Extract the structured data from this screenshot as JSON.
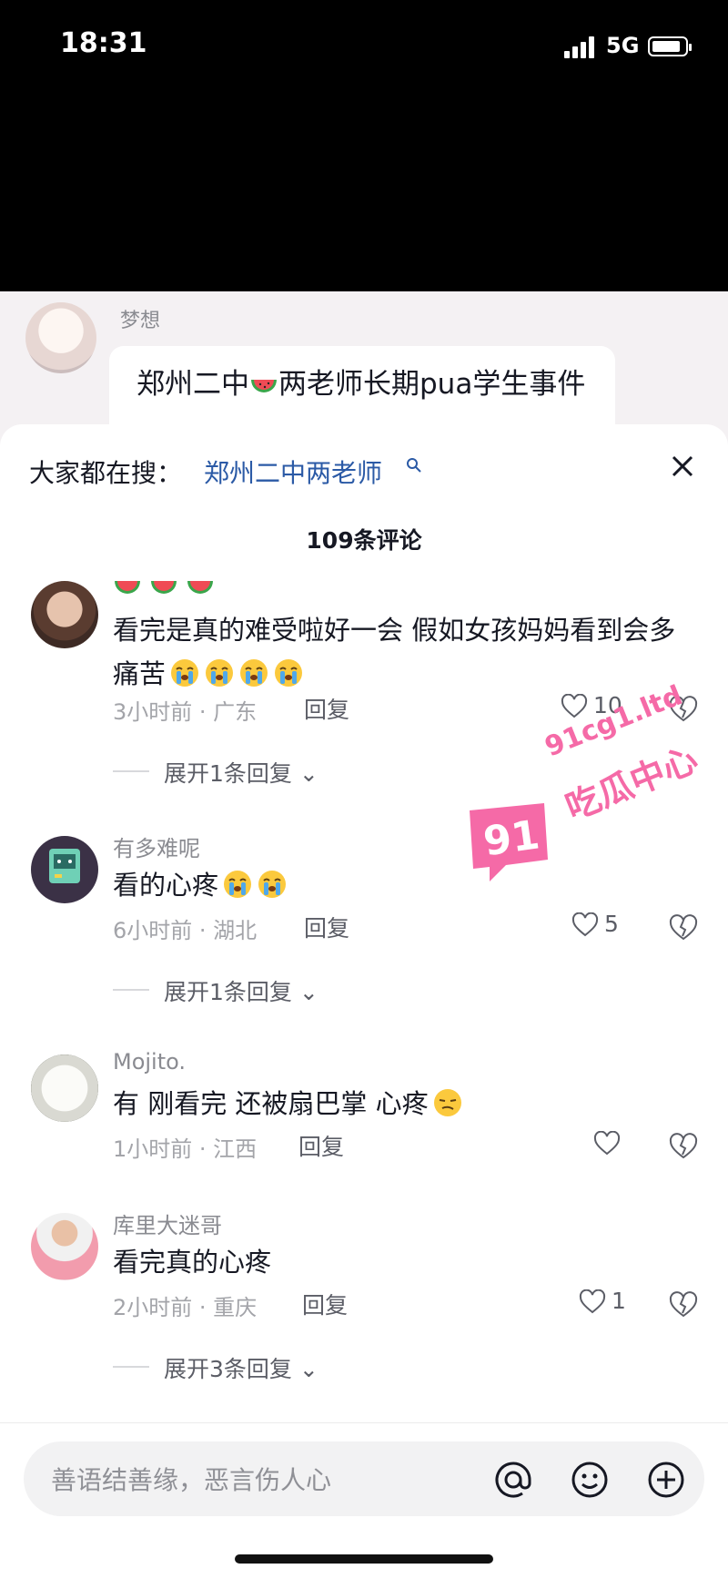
{
  "status_bar": {
    "time": "18:31",
    "network": "5G"
  },
  "chat": {
    "sender": "梦想",
    "message_part1": "郑州二中",
    "message_part2": "两老师长期pua学生事件"
  },
  "sheet": {
    "search_label": "大家都在搜：",
    "search_link": "郑州二中两老师",
    "comment_count": "109条评论"
  },
  "comments": [
    {
      "username": "",
      "text": "看完是真的难受啦好一会 假如女孩妈妈看到会多痛苦",
      "emoji_count": 4,
      "time_location": "3小时前 · 广东",
      "reply_label": "回复",
      "likes": "10",
      "expand_label": "展开1条回复"
    },
    {
      "username": "有多难呢",
      "text": "看的心疼",
      "emoji_count": 2,
      "time_location": "6小时前 · 湖北",
      "reply_label": "回复",
      "likes": "5",
      "expand_label": "展开1条回复"
    },
    {
      "username": "Mojito.",
      "text": "有 刚看完 还被扇巴掌 心疼",
      "emoji_count": 1,
      "time_location": "1小时前 · 江西",
      "reply_label": "回复",
      "likes": ""
    },
    {
      "username": "库里大迷哥",
      "text": "看完真的心疼",
      "emoji_count": 0,
      "time_location": "2小时前 · 重庆",
      "reply_label": "回复",
      "likes": "1",
      "expand_label": "展开3条回复"
    }
  ],
  "watermark": {
    "number": "91",
    "url": "91cg1.ltd",
    "name": "吃瓜中心"
  },
  "input": {
    "placeholder": "善语结善缘，恶言伤人心"
  },
  "colors": {
    "link": "#2b5aa6",
    "watermark": "#f56aa7",
    "muted": "#a3a4a9"
  }
}
